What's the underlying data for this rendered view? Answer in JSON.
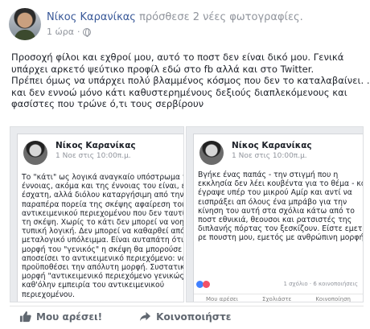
{
  "post": {
    "author": "Νίκος Καρανίκας",
    "headline_rest": " πρόσθεσε 2 νέες φωτογραφίες.",
    "time": "1 ώρα",
    "privacy_icon": "globe-icon",
    "text_lines": [
      "Προσοχή φίλοι και εχθροί μου, αυτό το ποστ δεν είναι δικό μου. Γενικά",
      "υπάρχει αρκετό ψεύτικο προφίλ εδώ στο fb αλλά και στο Twitter.",
      "Πρέπει όμως να υπάρχει πολύ βλαμμένος κόσμος που δεν το καταλαβαίνει. ...",
      "και δεν εννοώ μόνο κάτι καθυστερημένους δεξιούς διαπλεκόμενους και",
      "φασίστες που τρώνε ό,τι τους σερβίρουν"
    ]
  },
  "photos": [
    {
      "name": "Νίκος Καρανίκας",
      "date": "1 Νοε στις 10:00π.μ.",
      "lines": [
        "Το \"κάτι\" ως λογικά αναγκαίο υπόστρωμα της",
        "έννοιας, ακόμα και της έννοιας του είναι, είναι η",
        "έσχατη, αλλά διόλου καταργήσιμη από την",
        "παραπέρα πορεία της σκέψης αφαίρεση του",
        "αντικειμενικού περιεχομένου που δεν ταυτίζεται",
        "τη σκέψη. Χωρίς το κάτι δεν μπορεί να νοηθεί η",
        "τυπική λογική. Δεν μπορεί να καθαρθεί από το",
        "μεταλογικό υπόλειμμα. Είναι αυταπάτη ότι με τη",
        "μορφή του \"γενικός\" η σκέψη θα μπορούσε να",
        "αποσείσει το αντικειμενικό περιεχόμενο: να",
        "προϋποθέσει την απόλυτη μορφή. Συστατική γ",
        "μορφή \"αντικειμενικό περιεχόμενο γενικώς\" είν",
        "καθ'όλην εμπειρία του αντικειμενικού",
        "περιεχομένου."
      ]
    },
    {
      "name": "Νίκος Καρανίκας",
      "date": "1 Νοε στις 10:00π.μ.",
      "lines": [
        "Βγήκε ένας παπάς - την στιγμή που η",
        "εκκλησία δεν λέει κουβέντα για το θέμα - και",
        "έγραψε υπέρ του μικρού Αμίρ και αντί να",
        "εισπράξει απ όλους ένα μπράβο για την",
        "κίνηση του αυτή στα σχόλια κάτω από το",
        "ποστ εθνικιά, θεουσοι και ρατσιστές της",
        "διπλανής πόρτας τον ξεσκίζουν. Είστε εμετός",
        "ρε πουστη μου, εμετός με ανθρώπινη μορφή"
      ],
      "counts": "1 σχόλιο · 6 κοινοποιήσεις",
      "mini_actions": [
        "Μου αρέσει",
        "Σχολιάστε",
        "Κοινοποίηση"
      ]
    }
  ],
  "actions": [
    {
      "label": "Μου αρέσει!",
      "icon": "thumbs-up-icon"
    },
    {
      "label": "Κοινοποιήστε",
      "icon": "share-icon"
    }
  ],
  "colors": {
    "link": "#385898",
    "muted": "#90949c",
    "action": "#606770",
    "like": "#4080ff",
    "love": "#f25268"
  }
}
